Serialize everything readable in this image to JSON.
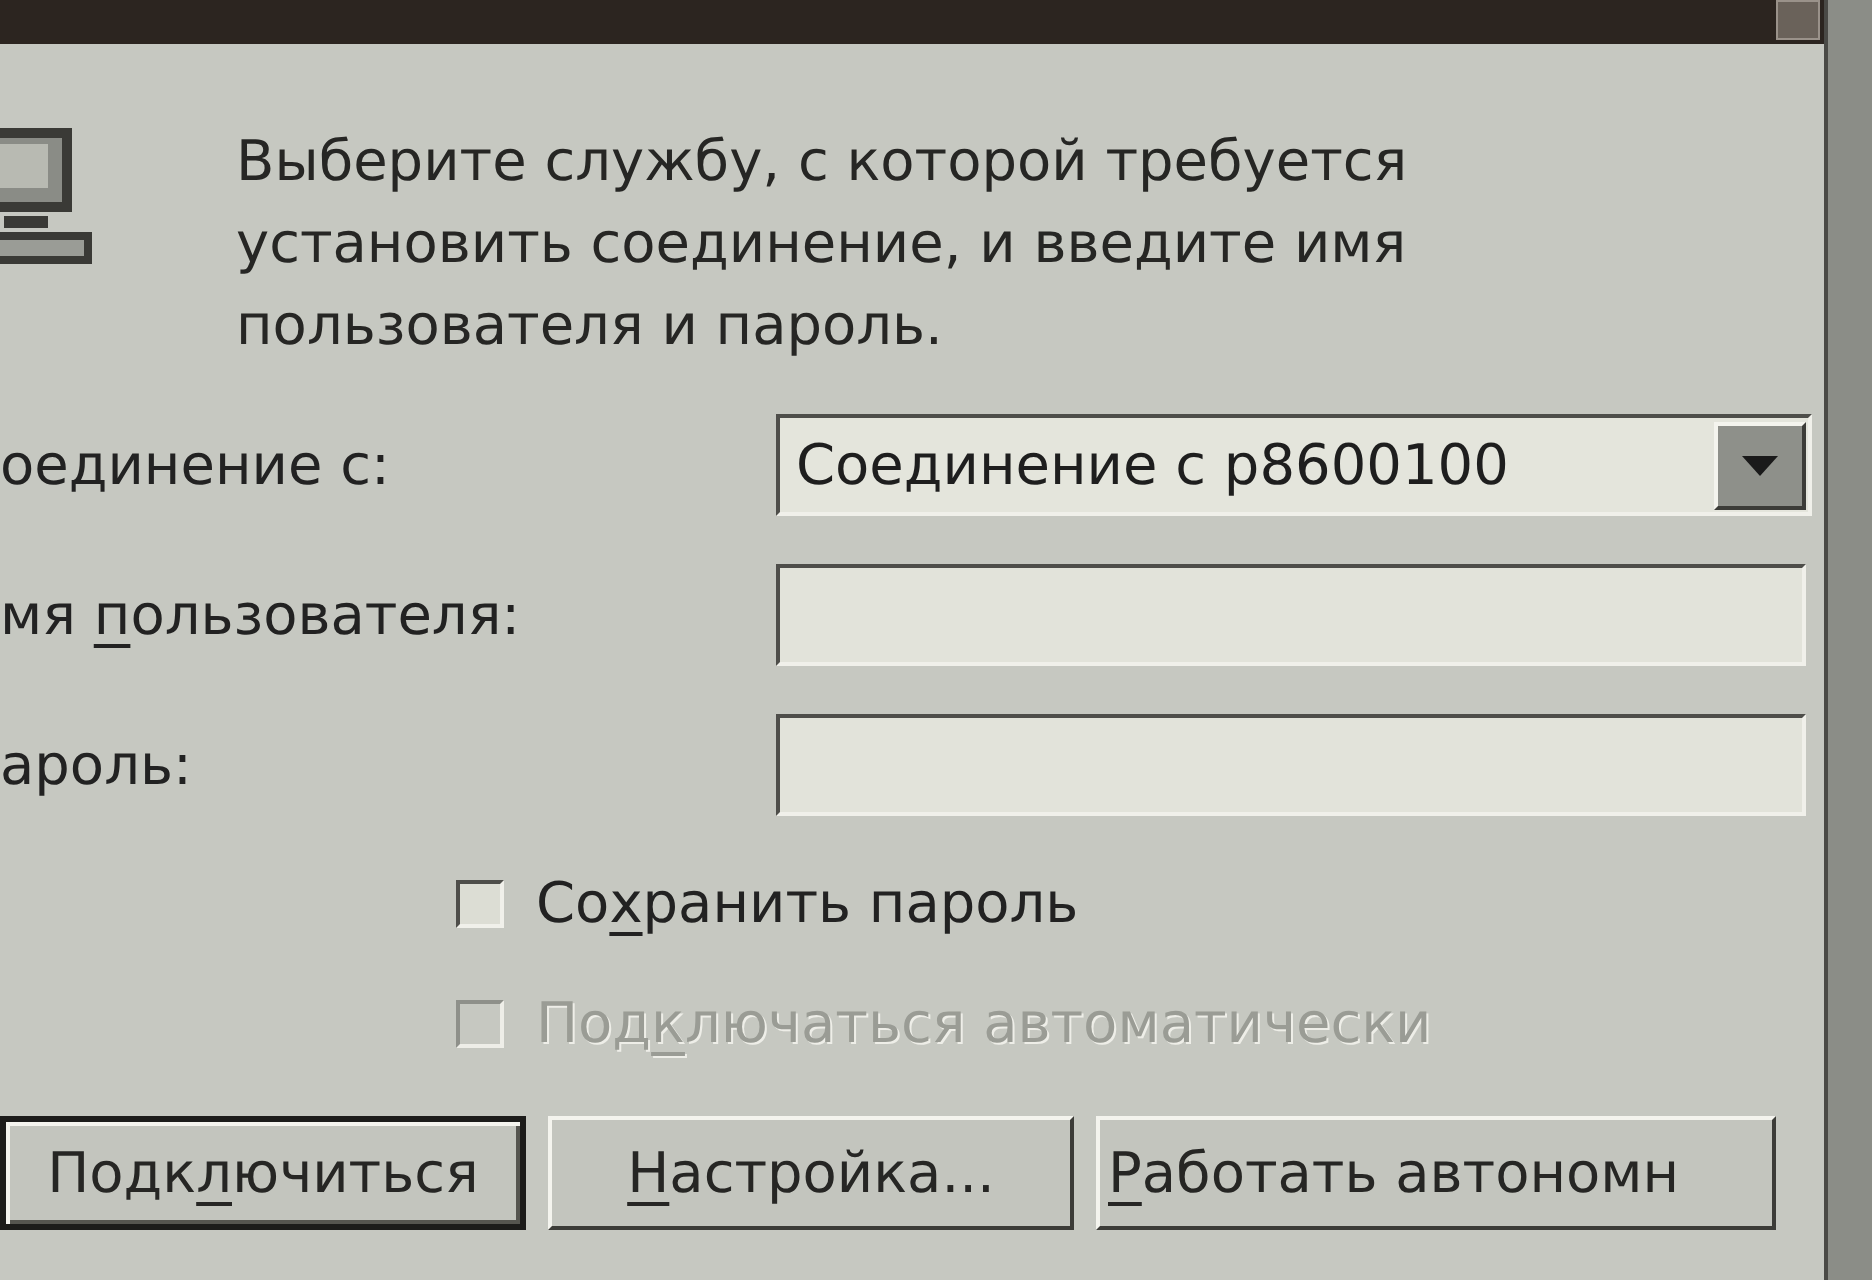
{
  "header": {
    "message": "Выберите службу, с которой требуется установить соединение, и введите имя пользователя и пароль."
  },
  "fields": [
    {
      "kind": "combo",
      "label": {
        "text": "оединение с:"
      },
      "value": "Соединение с p8600100"
    },
    {
      "kind": "text",
      "label": {
        "text": "мя ",
        "access_key": "п",
        "text_after": "ользователя:"
      }
    },
    {
      "kind": "text",
      "label": {
        "text": "ароль:"
      }
    }
  ],
  "checkboxes": [
    {
      "label": {
        "text": "Со",
        "access_key": "х",
        "text_after": "ранить пароль"
      },
      "checked": false,
      "disabled": false
    },
    {
      "label": {
        "text": "Под",
        "access_key": "к",
        "text_after": "лючаться автоматически"
      },
      "checked": false,
      "disabled": true
    }
  ],
  "buttons": [
    {
      "label": {
        "text": "Подк",
        "access_key": "л",
        "text_after": "ючиться"
      },
      "default": true
    },
    {
      "label": {
        "access_key": "Н",
        "text_after": "астройка..."
      },
      "default": false
    },
    {
      "label": {
        "access_key": "Р",
        "text_after": "аботать автономн"
      },
      "default": false
    }
  ]
}
